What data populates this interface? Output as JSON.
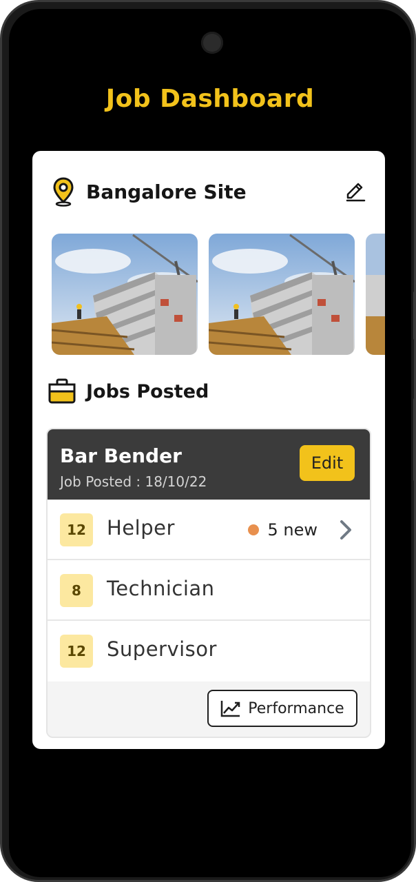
{
  "header": {
    "title": "Job Dashboard"
  },
  "site": {
    "name": "Bangalore Site"
  },
  "icons": {
    "location": "location-pin-icon",
    "edit": "pencil-edit-icon",
    "briefcase": "briefcase-icon",
    "chevron": "chevron-right-icon",
    "chart": "trend-chart-icon"
  },
  "jobs_section": {
    "title": "Jobs Posted"
  },
  "job": {
    "name": "Bar Bender",
    "posted": "Job Posted : 18/10/22",
    "edit_label": "Edit",
    "roles": [
      {
        "count": "12",
        "name": "Helper",
        "new": "5 new"
      },
      {
        "count": "8",
        "name": "Technician"
      },
      {
        "count": "12",
        "name": "Supervisor"
      }
    ]
  },
  "performance": {
    "label": "Performance"
  },
  "colors": {
    "accent": "#F2C21B",
    "dark_header": "#3B3B3B",
    "badge_bg": "#FCE8A0",
    "new_dot": "#E8904E"
  }
}
